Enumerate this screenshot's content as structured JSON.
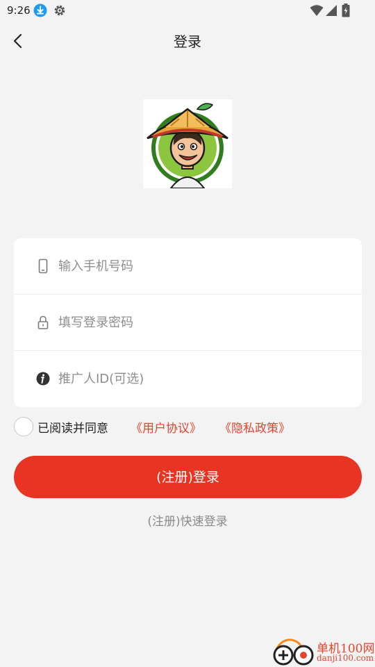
{
  "status_bar": {
    "time": "9:26",
    "icons": [
      "download-icon",
      "gear-icon",
      "wifi-icon",
      "cellular-icon",
      "battery-icon"
    ]
  },
  "app_bar": {
    "title": "登录",
    "back_icon": "chevron-left-icon"
  },
  "logo": {
    "description_icon": "farmer-avatar-logo"
  },
  "form": {
    "phone": {
      "placeholder": "输入手机号码",
      "value": "",
      "icon": "phone-icon"
    },
    "password": {
      "placeholder": "填写登录密码",
      "value": "",
      "icon": "lock-icon"
    },
    "referrer": {
      "placeholder": "推广人ID(可选)",
      "value": "",
      "icon": "info-icon"
    }
  },
  "agreement": {
    "checked": false,
    "text": "已阅读并同意",
    "user_agreement": "《用户协议》",
    "privacy_policy": "《隐私政策》"
  },
  "actions": {
    "login_label": "(注册)登录",
    "quick_login_label": "(注册)快速登录"
  },
  "watermark": {
    "name": "单机100网",
    "url": "danji100.com"
  },
  "colors": {
    "accent": "#e83422",
    "link": "#e2452f",
    "background": "#f3f3f3",
    "card": "#ffffff",
    "muted_text": "#8a8a8a"
  }
}
